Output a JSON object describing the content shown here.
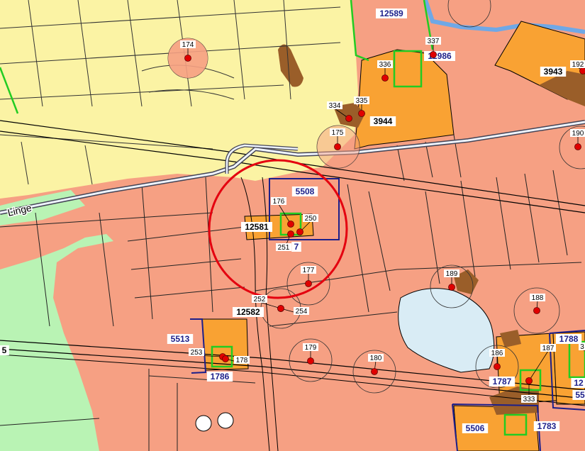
{
  "colors": {
    "residential": "#fbf3a4",
    "agricultural": "#f6a083",
    "nature": "#b9f3b4",
    "industry": "#f9a233",
    "forest": "#9a5e29",
    "water": "#d9ecf5",
    "boundary_navy": "#1c1f8a",
    "boundary_green": "#22cc22",
    "highlight_red": "#e4000f",
    "point_red": "#e00000"
  },
  "road_label": "Linge",
  "highlight": {
    "name": "highlight-circle"
  },
  "parcels": [
    {
      "id": "p12589",
      "label": "12589",
      "style": "navy"
    },
    {
      "id": "p12986",
      "label": "12986",
      "style": "navy"
    },
    {
      "id": "p3943",
      "label": "3943",
      "style": "black"
    },
    {
      "id": "p3944",
      "label": "3944",
      "style": "black"
    },
    {
      "id": "p5508",
      "label": "5508",
      "style": "navy"
    },
    {
      "id": "p12581",
      "label": "12581",
      "style": "black"
    },
    {
      "id": "p12582",
      "label": "12582",
      "style": "black"
    },
    {
      "id": "p5513",
      "label": "5513",
      "style": "navy"
    },
    {
      "id": "p1786",
      "label": "1786",
      "style": "navy"
    },
    {
      "id": "p1787",
      "label": "1787",
      "style": "navy"
    },
    {
      "id": "p1788",
      "label": "1788",
      "style": "navy"
    },
    {
      "id": "p5506",
      "label": "5506",
      "style": "navy"
    },
    {
      "id": "p1783",
      "label": "1783",
      "style": "navy"
    },
    {
      "id": "p7",
      "label": "7",
      "style": "navy"
    },
    {
      "id": "p5",
      "label": "5",
      "style": "black"
    },
    {
      "id": "p12edge",
      "label": "12",
      "style": "navy"
    },
    {
      "id": "p55edge",
      "label": "55",
      "style": "navy"
    }
  ],
  "points": [
    {
      "id": "pt174",
      "label": "174"
    },
    {
      "id": "pt337",
      "label": "337"
    },
    {
      "id": "pt336",
      "label": "336"
    },
    {
      "id": "pt192",
      "label": "192"
    },
    {
      "id": "pt334",
      "label": "334"
    },
    {
      "id": "pt335",
      "label": "335"
    },
    {
      "id": "pt175",
      "label": "175"
    },
    {
      "id": "pt190",
      "label": "190"
    },
    {
      "id": "pt176",
      "label": "176"
    },
    {
      "id": "pt250",
      "label": "250"
    },
    {
      "id": "pt251",
      "label": "251"
    },
    {
      "id": "pt177",
      "label": "177"
    },
    {
      "id": "pt189",
      "label": "189"
    },
    {
      "id": "pt188",
      "label": "188"
    },
    {
      "id": "pt252",
      "label": "252"
    },
    {
      "id": "pt254",
      "label": "254"
    },
    {
      "id": "pt253",
      "label": "253"
    },
    {
      "id": "pt178",
      "label": "178"
    },
    {
      "id": "pt179",
      "label": "179"
    },
    {
      "id": "pt180",
      "label": "180"
    },
    {
      "id": "pt186",
      "label": "186"
    },
    {
      "id": "pt187",
      "label": "187"
    },
    {
      "id": "pt333",
      "label": "333"
    },
    {
      "id": "pt3edge",
      "label": "3"
    }
  ]
}
